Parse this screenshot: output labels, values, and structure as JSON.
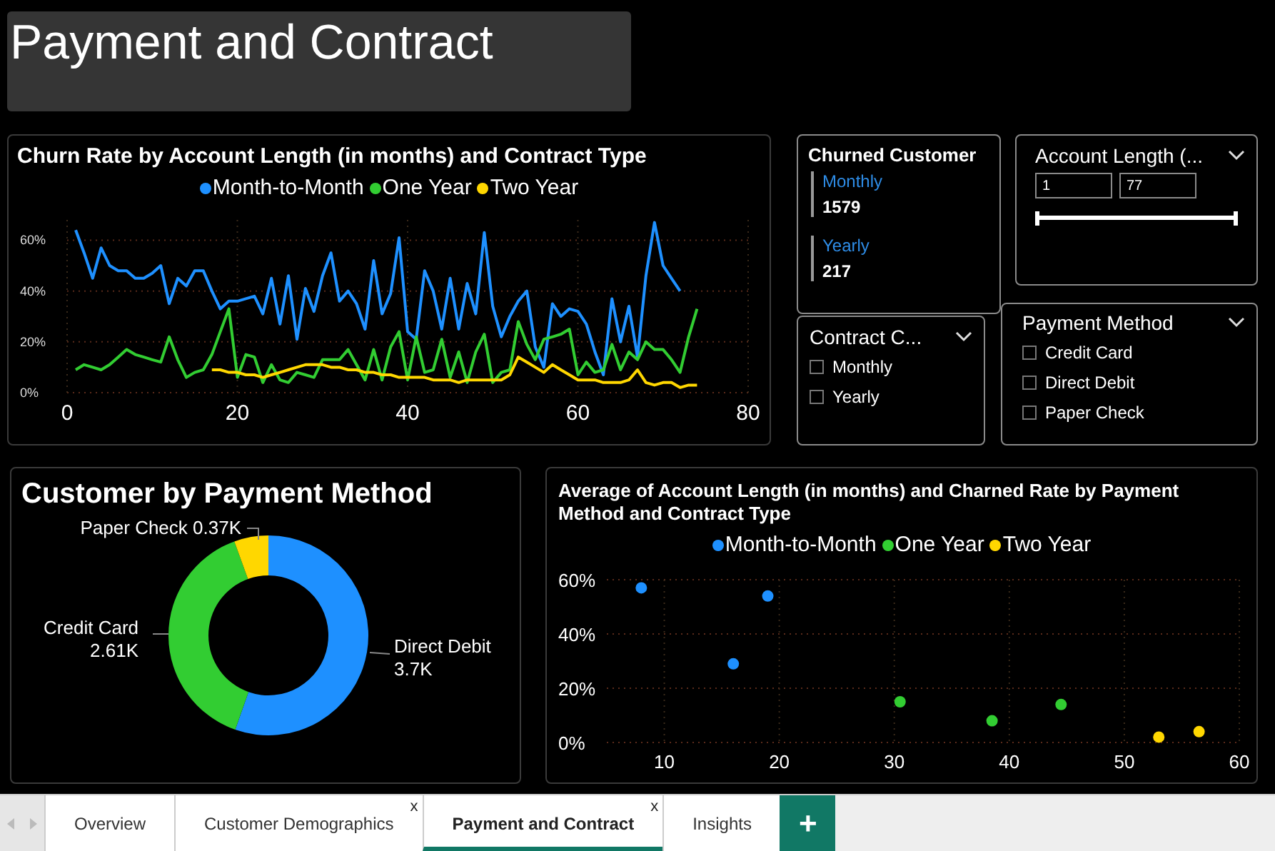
{
  "title": "Payment and Contract",
  "churn_chart": {
    "chart_data": {
      "type": "line",
      "title": "Churn Rate by Account Length (in months) and Contract Type",
      "x": [
        1,
        2,
        3,
        4,
        5,
        6,
        7,
        8,
        9,
        10,
        11,
        12,
        13,
        14,
        15,
        16,
        17,
        18,
        19,
        20,
        21,
        22,
        23,
        24,
        25,
        26,
        27,
        28,
        29,
        30,
        31,
        32,
        33,
        34,
        35,
        36,
        37,
        38,
        39,
        40,
        41,
        42,
        43,
        44,
        45,
        46,
        47,
        48,
        49,
        50,
        51,
        52,
        53,
        54,
        55,
        56,
        57,
        58,
        59,
        60,
        61,
        62,
        63,
        64,
        65,
        66,
        67,
        68,
        69,
        70,
        71,
        72,
        73,
        74
      ],
      "series": [
        {
          "name": "Month-to-Month",
          "color": "#1e90ff",
          "values": [
            64,
            55,
            45,
            57,
            50,
            48,
            48,
            45,
            45,
            47,
            50,
            35,
            45,
            42,
            48,
            48,
            40,
            33,
            36,
            36,
            37,
            38,
            31,
            45,
            27,
            46,
            21,
            41,
            32,
            46,
            55,
            36,
            40,
            35,
            25,
            52,
            31,
            39,
            61,
            24,
            21,
            48,
            40,
            25,
            45,
            25,
            43,
            31,
            63,
            34,
            22,
            30,
            36,
            40,
            18,
            10,
            35,
            30,
            33,
            32,
            27,
            16,
            7,
            37,
            20,
            34,
            14,
            46,
            67,
            50,
            45,
            40,
            null,
            null
          ]
        },
        {
          "name": "One Year",
          "color": "#32cd32",
          "values": [
            9,
            11,
            10,
            9,
            11,
            14,
            17,
            15,
            14,
            13,
            12,
            22,
            13,
            6,
            8,
            9,
            15,
            24,
            33,
            6,
            15,
            14,
            4,
            11,
            5,
            4,
            8,
            7,
            6,
            13,
            13,
            13,
            17,
            11,
            5,
            17,
            5,
            18,
            24,
            5,
            22,
            8,
            9,
            21,
            6,
            16,
            4,
            16,
            23,
            4,
            8,
            9,
            28,
            19,
            13,
            21,
            22,
            23,
            25,
            7,
            12,
            8,
            9,
            19,
            9,
            16,
            13,
            20,
            17,
            17,
            13,
            8,
            22,
            33
          ]
        },
        {
          "name": "Two Year",
          "color": "#ffd700",
          "values": [
            null,
            null,
            null,
            null,
            null,
            null,
            null,
            null,
            null,
            null,
            null,
            null,
            null,
            null,
            null,
            null,
            9,
            9,
            8,
            8,
            7,
            7,
            6,
            7,
            8,
            9,
            10,
            11,
            11,
            11,
            10,
            10,
            9,
            9,
            8,
            8,
            7,
            7,
            6,
            6,
            6,
            6,
            5,
            5,
            5,
            4,
            5,
            5,
            5,
            5,
            5,
            7,
            14,
            12,
            10,
            8,
            11,
            9,
            7,
            5,
            5,
            5,
            4,
            4,
            4,
            5,
            9,
            4,
            3,
            4,
            4,
            2,
            3,
            3
          ]
        }
      ],
      "xlim": [
        0,
        80
      ],
      "ylim": [
        0,
        68
      ],
      "grid": true,
      "xticks": [
        0,
        20,
        40,
        60,
        80
      ],
      "yticks": [
        {
          "value": 0,
          "label": "0%"
        },
        {
          "value": 20,
          "label": "20%"
        },
        {
          "value": 40,
          "label": "40%"
        },
        {
          "value": 60,
          "label": "60%"
        }
      ]
    }
  },
  "churned": {
    "title": "Churned Customer",
    "items": [
      {
        "label": "Monthly",
        "value": "1579"
      },
      {
        "label": "Yearly",
        "value": "217"
      }
    ]
  },
  "account_length": {
    "title": "Account Length (...",
    "min_value": "1",
    "max_value": "77",
    "level": 1
  },
  "contract_filter": {
    "title": "Contract C...",
    "options": [
      {
        "label": "Monthly",
        "checked": false
      },
      {
        "label": "Yearly",
        "checked": false
      }
    ]
  },
  "payment_filter": {
    "title": "Payment Method",
    "options": [
      {
        "label": "Credit Card",
        "checked": false
      },
      {
        "label": "Direct Debit",
        "checked": false
      },
      {
        "label": "Paper Check",
        "checked": false
      }
    ]
  },
  "payment_chart": {
    "chart_data": {
      "type": "donut",
      "title": "Customer by Payment Method",
      "categories": [
        "Direct Debit",
        "Credit Card",
        "Paper Check"
      ],
      "values": [
        3700,
        2610,
        370
      ],
      "colors": [
        "#1e90ff",
        "#32cd32",
        "#ffd700"
      ],
      "value_labels": [
        "3.7K",
        "2.61K",
        "0.37K"
      ]
    }
  },
  "scatter_chart": {
    "chart_data": {
      "type": "scatter",
      "title": "Average of Account Length (in months) and Charned Rate by Payment Method and Contract Type",
      "series": [
        {
          "name": "Month-to-Month",
          "color": "#1e90ff",
          "x": [
            8,
            16,
            19
          ],
          "values": [
            57,
            29,
            54
          ]
        },
        {
          "name": "One Year",
          "color": "#32cd32",
          "x": [
            30.5,
            38.5,
            44.5
          ],
          "values": [
            15,
            8,
            14
          ]
        },
        {
          "name": "Two Year",
          "color": "#ffd700",
          "x": [
            53,
            56.5
          ],
          "values": [
            2,
            4
          ]
        }
      ],
      "xlim": [
        5,
        60
      ],
      "ylim": [
        0,
        60
      ],
      "grid": true,
      "xticks": [
        10,
        20,
        30,
        40,
        50,
        60
      ],
      "yticks": [
        {
          "value": 0,
          "label": "0%"
        },
        {
          "value": 20,
          "label": "20%"
        },
        {
          "value": 40,
          "label": "40%"
        },
        {
          "value": 60,
          "label": "60%"
        }
      ]
    }
  },
  "tabs": [
    {
      "label": "Overview",
      "selected": false
    },
    {
      "label": "Customer Demographics",
      "selected": false,
      "close": "x"
    },
    {
      "label": "Payment and Contract",
      "selected": true,
      "close": "x"
    },
    {
      "label": "Insights",
      "selected": false
    }
  ],
  "add_tab": "+"
}
